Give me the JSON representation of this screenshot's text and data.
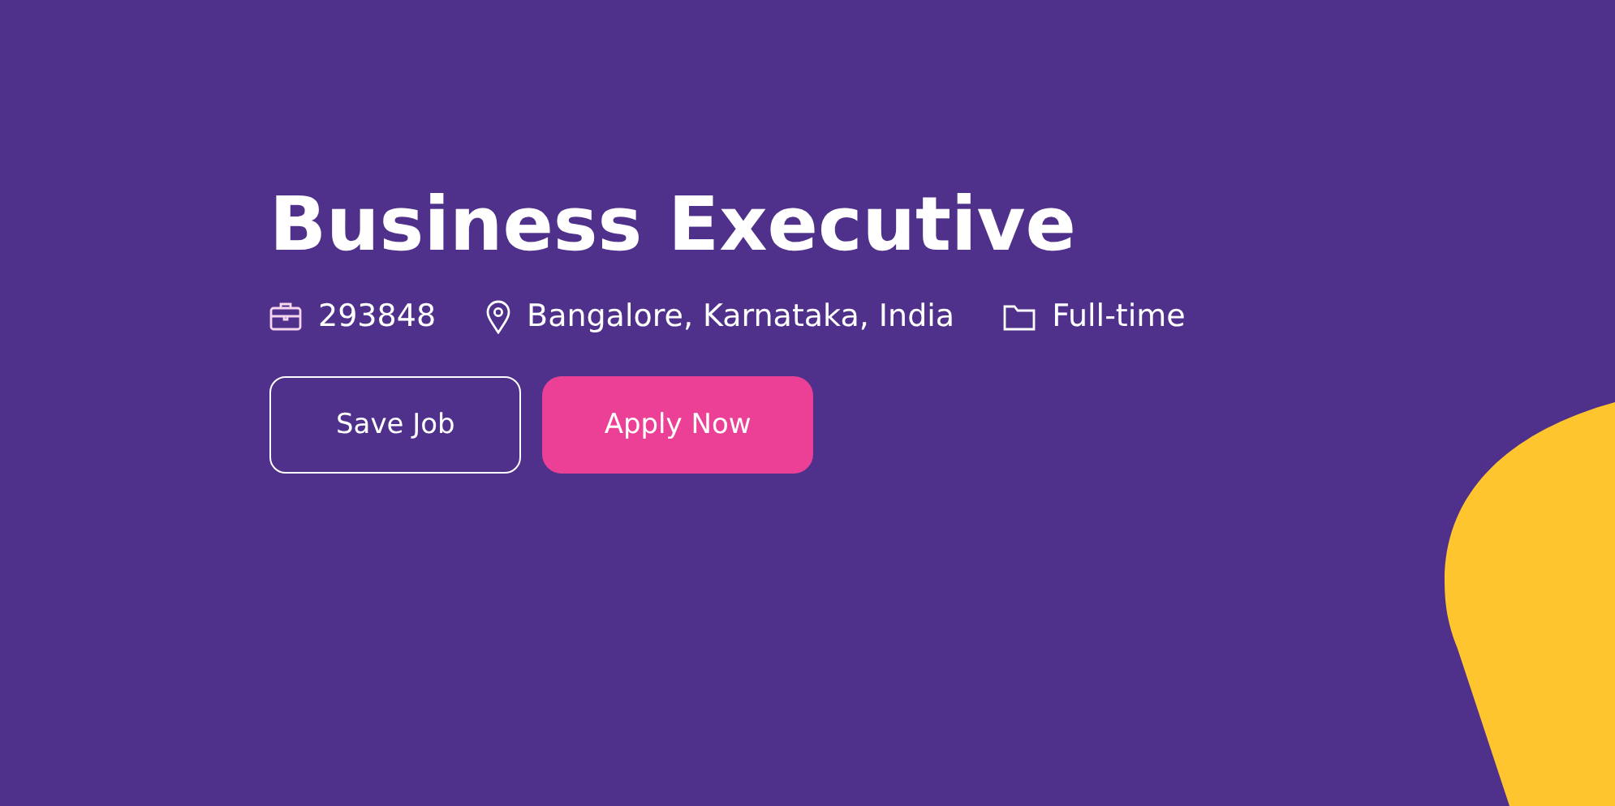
{
  "title": "Business Executive",
  "meta": [
    {
      "kind": "job-id",
      "text": "293848"
    },
    {
      "kind": "location",
      "text": "Bangalore, Karnataka, India"
    },
    {
      "kind": "type",
      "text": "Full-time"
    }
  ],
  "buttons": [
    {
      "kind": "outline",
      "label": "Save Job"
    },
    {
      "kind": "filled",
      "label": "Apply Now"
    }
  ]
}
